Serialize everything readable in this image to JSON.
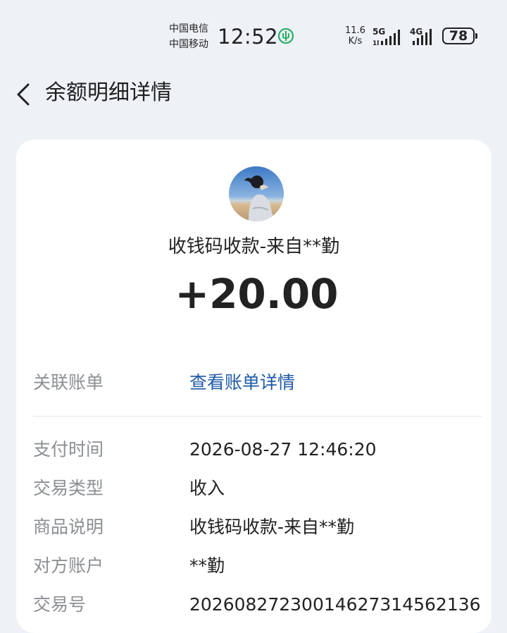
{
  "status_bar": {
    "carrier_1": "中国电信",
    "carrier_2": "中国移动",
    "time": "12:52",
    "net_speed_value": "11.6",
    "net_speed_unit": "K/s",
    "signal_1_label": "5G",
    "signal_2_label": "4G",
    "battery": "78"
  },
  "header": {
    "title": "余额明细详情"
  },
  "transaction": {
    "title": "收钱码收款-来自**勤",
    "amount": "+20.00"
  },
  "details": [
    {
      "label": "关联账单",
      "value": "查看账单详情"
    },
    {
      "label": "支付时间",
      "value": "2026-08-27 12:46:20"
    },
    {
      "label": "交易类型",
      "value": "收入"
    },
    {
      "label": "商品说明",
      "value": "收钱码收款-来自**勤"
    },
    {
      "label": "对方账户",
      "value": "**勤"
    },
    {
      "label": "交易号",
      "value": "20260827230014627314562136"
    }
  ],
  "colors": {
    "background": "#eef1f6",
    "card": "#ffffff",
    "link": "#1f5aa8",
    "label": "#8c8f94",
    "wechat_green": "#2aae67"
  },
  "icons": {
    "back": "chevron-left-icon",
    "wechat": "wechat-icon",
    "battery": "battery-icon"
  }
}
